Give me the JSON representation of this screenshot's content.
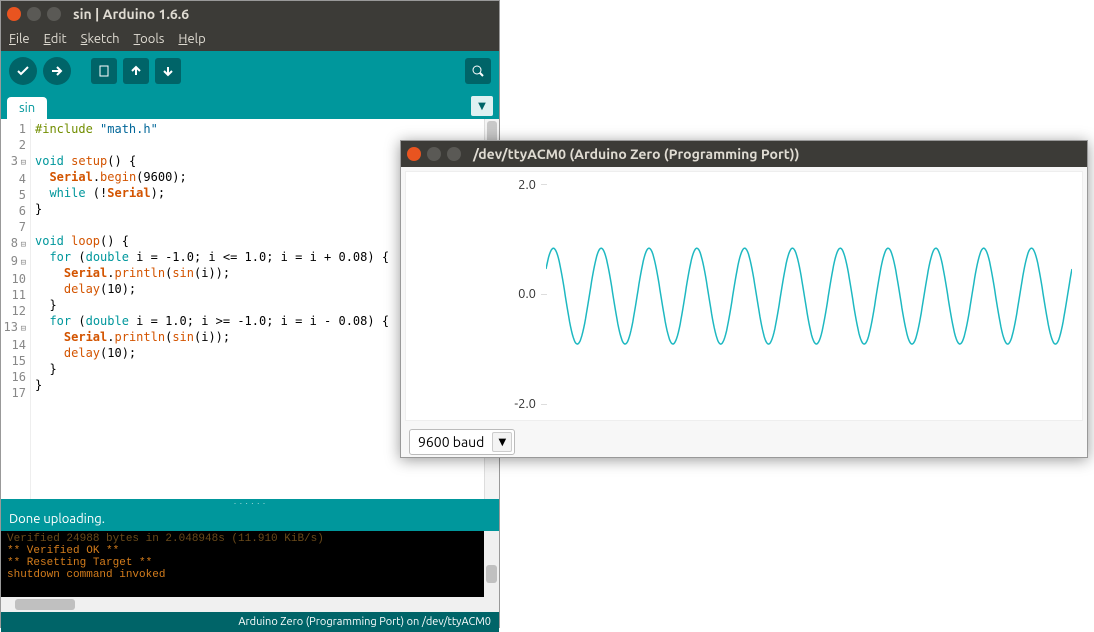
{
  "ide": {
    "title": "sin | Arduino 1.6.6",
    "menu": {
      "file": "File",
      "edit": "Edit",
      "sketch": "Sketch",
      "tools": "Tools",
      "help": "Help"
    },
    "tab": "sin",
    "status": "Done uploading.",
    "footer": "Arduino Zero (Programming Port) on /dev/ttyACM0",
    "code": {
      "l1_pp": "#include ",
      "l1_str": "\"math.h\"",
      "l3a": "void",
      "l3b": " setup",
      "l3c": "() {",
      "l4a": "  ",
      "l4b": "Serial",
      "l4c": ".",
      "l4d": "begin",
      "l4e": "(9600);",
      "l5a": "  ",
      "l5b": "while",
      "l5c": " (!",
      "l5d": "Serial",
      "l5e": ");",
      "l6": "}",
      "l8a": "void",
      "l8b": " loop",
      "l8c": "() {",
      "l9a": "  ",
      "l9b": "for",
      "l9c": " (",
      "l9d": "double",
      "l9e": " i = -1.0; i <= 1.0; i = i + 0.08) {",
      "l10a": "    ",
      "l10b": "Serial",
      "l10c": ".",
      "l10d": "println",
      "l10e": "(",
      "l10f": "sin",
      "l10g": "(i));",
      "l11a": "    ",
      "l11b": "delay",
      "l11c": "(10);",
      "l12": "  }",
      "l13a": "  ",
      "l13b": "for",
      "l13c": " (",
      "l13d": "double",
      "l13e": " i = 1.0; i >= -1.0; i = i - 0.08) {",
      "l14a": "    ",
      "l14b": "Serial",
      "l14c": ".",
      "l14d": "println",
      "l14e": "(",
      "l14f": "sin",
      "l14g": "(i));",
      "l15a": "    ",
      "l15b": "delay",
      "l15c": "(10);",
      "l16": "  }",
      "l17": "}"
    },
    "console": {
      "l0": "Verified 24988 bytes in 2.048948s (11.910 KiB/s)",
      "l1": "** Verified OK **",
      "l2": "** Resetting Target **",
      "l3": "shutdown command invoked"
    },
    "gutter": [
      "1",
      "2",
      "3",
      "4",
      "5",
      "6",
      "7",
      "8",
      "9",
      "10",
      "11",
      "12",
      "13",
      "14",
      "15",
      "16",
      "17"
    ]
  },
  "plotter": {
    "title": "/dev/ttyACM0 (Arduino Zero (Programming Port))",
    "baud": "9600 baud",
    "ylabels": {
      "top": "2.0",
      "mid": "0.0",
      "bot": "-2.0"
    }
  },
  "chart_data": {
    "type": "line",
    "title": "",
    "xlabel": "",
    "ylabel": "",
    "ylim": [
      -2.0,
      2.0
    ],
    "yticks": [
      -2.0,
      0.0,
      2.0
    ],
    "series": [
      {
        "name": "sin(i)",
        "color": "#1eb8c1",
        "amplitude": 0.84,
        "cycles_visible": 11,
        "description": "triangular-period sine wave: sin(i) for i sweeping -1..1..-1 step 0.08"
      }
    ]
  }
}
